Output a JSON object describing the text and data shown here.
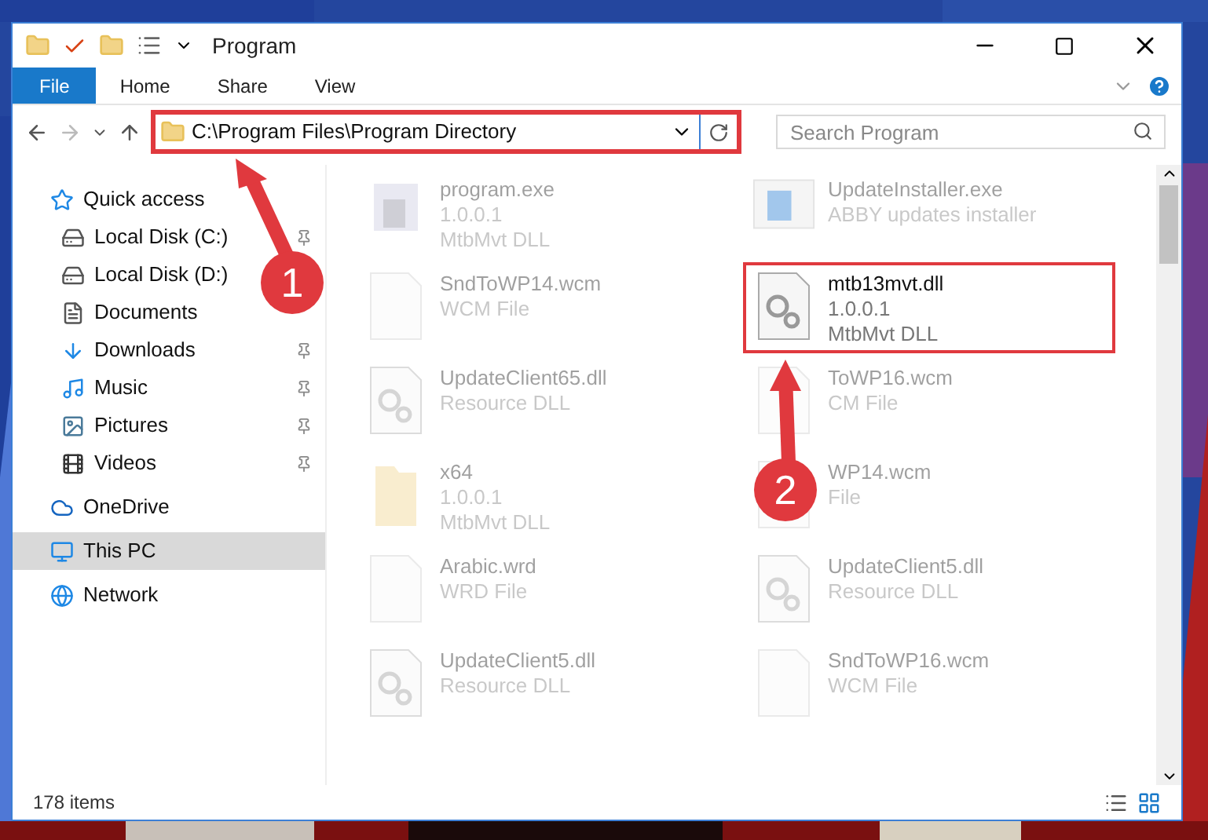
{
  "window": {
    "title": "Program"
  },
  "ribbon_tabs": [
    {
      "label": "File",
      "selected": true
    },
    {
      "label": "Home",
      "selected": false
    },
    {
      "label": "Share",
      "selected": false
    },
    {
      "label": "View",
      "selected": false
    }
  ],
  "address": {
    "value": "C:\\Program Files\\Program Directory",
    "highlighted": true
  },
  "search": {
    "placeholder": "Search Program"
  },
  "sidebar": {
    "items": [
      {
        "label": "Quick access",
        "kind": "star",
        "group": true,
        "pinned": false,
        "selected": false
      },
      {
        "label": "Local Disk (C:)",
        "kind": "disk",
        "group": false,
        "pinned": true,
        "selected": false
      },
      {
        "label": "Local Disk (D:)",
        "kind": "disk",
        "group": false,
        "pinned": false,
        "selected": false
      },
      {
        "label": "Documents",
        "kind": "documents",
        "group": false,
        "pinned": false,
        "selected": false
      },
      {
        "label": "Downloads",
        "kind": "downloads",
        "group": false,
        "pinned": true,
        "selected": false
      },
      {
        "label": "Music",
        "kind": "music",
        "group": false,
        "pinned": true,
        "selected": false
      },
      {
        "label": "Pictures",
        "kind": "pictures",
        "group": false,
        "pinned": true,
        "selected": false
      },
      {
        "label": "Videos",
        "kind": "videos",
        "group": false,
        "pinned": true,
        "selected": false
      },
      {
        "label": "OneDrive",
        "kind": "cloud",
        "group": true,
        "pinned": false,
        "selected": false
      },
      {
        "label": "This PC",
        "kind": "pc",
        "group": true,
        "pinned": false,
        "selected": true
      },
      {
        "label": "Network",
        "kind": "network",
        "group": true,
        "pinned": false,
        "selected": false
      }
    ]
  },
  "files": [
    {
      "name": "program.exe",
      "lines": [
        "1.0.0.1",
        "MtbMvt DLL"
      ],
      "kind": "exe",
      "highlighted": false
    },
    {
      "name": "UpdateInstaller.exe",
      "lines": [
        "ABBY updates installer"
      ],
      "kind": "installer",
      "highlighted": false
    },
    {
      "name": "SndToWP14.wcm",
      "lines": [
        "WCM File"
      ],
      "kind": "blank",
      "highlighted": false
    },
    {
      "name": "mtb13mvt.dll",
      "lines": [
        "1.0.0.1",
        "MtbMvt DLL"
      ],
      "kind": "dll",
      "highlighted": true
    },
    {
      "name": "UpdateClient65.dll",
      "lines": [
        "Resource DLL"
      ],
      "kind": "dll",
      "highlighted": false
    },
    {
      "name": "ToWP16.wcm",
      "lines": [
        "CM File"
      ],
      "kind": "blank",
      "highlighted": false
    },
    {
      "name": "x64",
      "lines": [
        "1.0.0.1",
        "MtbMvt DLL"
      ],
      "kind": "folder",
      "highlighted": false
    },
    {
      "name": "WP14.wcm",
      "lines": [
        "File"
      ],
      "kind": "blank",
      "highlighted": false
    },
    {
      "name": "Arabic.wrd",
      "lines": [
        "WRD File"
      ],
      "kind": "blank",
      "highlighted": false
    },
    {
      "name": "UpdateClient5.dll",
      "lines": [
        "Resource DLL"
      ],
      "kind": "dll",
      "highlighted": false
    },
    {
      "name": "UpdateClient5.dll",
      "lines": [
        "Resource DLL"
      ],
      "kind": "dll",
      "highlighted": false
    },
    {
      "name": "SndToWP16.wcm",
      "lines": [
        "WCM File"
      ],
      "kind": "blank",
      "highlighted": false
    }
  ],
  "annotations": [
    {
      "label": "1"
    },
    {
      "label": "2"
    }
  ],
  "status_bar": {
    "count": "178 items"
  }
}
